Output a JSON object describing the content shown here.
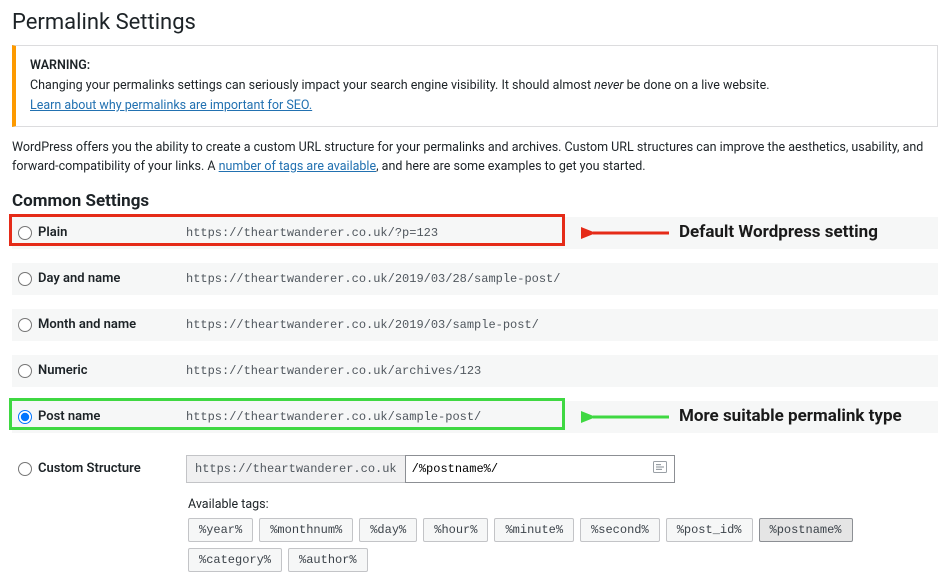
{
  "page_title": "Permalink Settings",
  "warning": {
    "heading": "WARNING:",
    "line1_a": "Changing your permalinks settings can seriously impact your search engine visibility. It should almost ",
    "line1_em": "never",
    "line1_b": " be done on a live website.",
    "link": "Learn about why permalinks are important for SEO."
  },
  "intro": {
    "text_a": "WordPress offers you the ability to create a custom URL structure for your permalinks and archives. Custom URL structures can improve the aesthetics, usability, and forward-compatibility of your links. A ",
    "link": "number of tags are available",
    "text_b": ", and here are some examples to get you started."
  },
  "section_title": "Common Settings",
  "options": {
    "plain": {
      "label": "Plain",
      "example": "https://theartwanderer.co.uk/?p=123"
    },
    "dayname": {
      "label": "Day and name",
      "example": "https://theartwanderer.co.uk/2019/03/28/sample-post/"
    },
    "monthname": {
      "label": "Month and name",
      "example": "https://theartwanderer.co.uk/2019/03/sample-post/"
    },
    "numeric": {
      "label": "Numeric",
      "example": "https://theartwanderer.co.uk/archives/123"
    },
    "postname": {
      "label": "Post name",
      "example": "https://theartwanderer.co.uk/sample-post/"
    },
    "custom": {
      "label": "Custom Structure",
      "prefix": "https://theartwanderer.co.uk",
      "value": "/%postname%/"
    }
  },
  "available_tags_label": "Available tags:",
  "tags": [
    "%year%",
    "%monthnum%",
    "%day%",
    "%hour%",
    "%minute%",
    "%second%",
    "%post_id%",
    "%postname%",
    "%category%",
    "%author%"
  ],
  "active_tag": "%postname%",
  "annotations": {
    "default_label": "Default Wordpress setting",
    "suitable_label": "More suitable permalink type"
  }
}
